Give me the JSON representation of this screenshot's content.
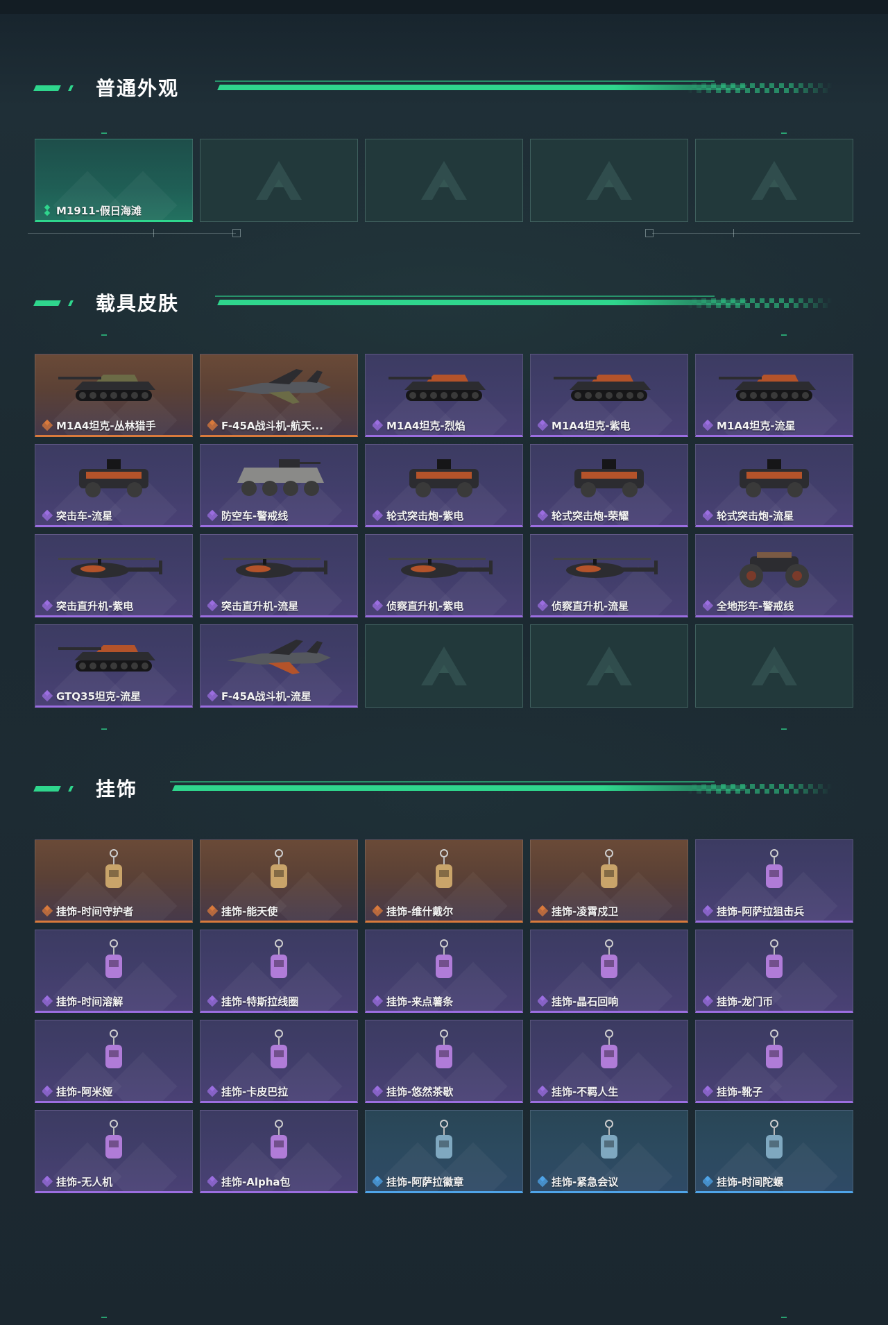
{
  "sections": {
    "normal": {
      "title": "普通外观",
      "items": [
        {
          "label": "M1911-假日海滩",
          "rarity": "green",
          "art": "pistol-icon"
        },
        {
          "label": "",
          "rarity": "empty"
        },
        {
          "label": "",
          "rarity": "empty"
        },
        {
          "label": "",
          "rarity": "empty"
        },
        {
          "label": "",
          "rarity": "empty"
        }
      ]
    },
    "vehicle": {
      "title": "载具皮肤",
      "items": [
        {
          "label": "M1A4坦克-丛林猎手",
          "rarity": "orange",
          "art": "tank-icon"
        },
        {
          "label": "F-45A战斗机-航天...",
          "rarity": "orange",
          "art": "jet-icon"
        },
        {
          "label": "M1A4坦克-烈焰",
          "rarity": "purple",
          "art": "tank-icon"
        },
        {
          "label": "M1A4坦克-紫电",
          "rarity": "purple",
          "art": "tank-icon"
        },
        {
          "label": "M1A4坦克-流星",
          "rarity": "purple",
          "art": "tank-icon"
        },
        {
          "label": "突击车-流星",
          "rarity": "purple",
          "art": "armored-car-icon"
        },
        {
          "label": "防空车-警戒线",
          "rarity": "purple",
          "art": "apc-icon"
        },
        {
          "label": "轮式突击炮-紫电",
          "rarity": "purple",
          "art": "armored-car-icon"
        },
        {
          "label": "轮式突击炮-荣耀",
          "rarity": "purple",
          "art": "armored-car-icon"
        },
        {
          "label": "轮式突击炮-流星",
          "rarity": "purple",
          "art": "armored-car-icon"
        },
        {
          "label": "突击直升机-紫电",
          "rarity": "purple",
          "art": "helicopter-icon"
        },
        {
          "label": "突击直升机-流星",
          "rarity": "purple",
          "art": "helicopter-icon"
        },
        {
          "label": "侦察直升机-紫电",
          "rarity": "purple",
          "art": "helicopter-icon"
        },
        {
          "label": "侦察直升机-流星",
          "rarity": "purple",
          "art": "helicopter-icon"
        },
        {
          "label": "全地形车-警戒线",
          "rarity": "purple",
          "art": "atv-icon"
        },
        {
          "label": "GTQ35坦克-流星",
          "rarity": "purple",
          "art": "tank-icon"
        },
        {
          "label": "F-45A战斗机-流星",
          "rarity": "purple",
          "art": "jet-icon"
        },
        {
          "label": "",
          "rarity": "empty"
        },
        {
          "label": "",
          "rarity": "empty"
        },
        {
          "label": "",
          "rarity": "empty"
        }
      ]
    },
    "charm": {
      "title": "挂饰",
      "items": [
        {
          "label": "挂饰-时间守护者",
          "rarity": "orange",
          "art": "charm-icon"
        },
        {
          "label": "挂饰-能天使",
          "rarity": "orange",
          "art": "charm-icon"
        },
        {
          "label": "挂饰-维什戴尔",
          "rarity": "orange",
          "art": "charm-icon"
        },
        {
          "label": "挂饰-凌霄戍卫",
          "rarity": "orange",
          "art": "charm-icon"
        },
        {
          "label": "挂饰-阿萨拉狙击兵",
          "rarity": "purple",
          "art": "charm-icon"
        },
        {
          "label": "挂饰-时间溶解",
          "rarity": "purple",
          "art": "charm-icon"
        },
        {
          "label": "挂饰-特斯拉线圈",
          "rarity": "purple",
          "art": "charm-icon"
        },
        {
          "label": "挂饰-来点薯条",
          "rarity": "purple",
          "art": "charm-icon"
        },
        {
          "label": "挂饰-晶石回响",
          "rarity": "purple",
          "art": "charm-icon"
        },
        {
          "label": "挂饰-龙门币",
          "rarity": "purple",
          "art": "charm-icon"
        },
        {
          "label": "挂饰-阿米娅",
          "rarity": "purple",
          "art": "charm-icon"
        },
        {
          "label": "挂饰-卡皮巴拉",
          "rarity": "purple",
          "art": "charm-icon"
        },
        {
          "label": "挂饰-悠然茶歇",
          "rarity": "purple",
          "art": "charm-icon"
        },
        {
          "label": "挂饰-不羁人生",
          "rarity": "purple",
          "art": "charm-icon"
        },
        {
          "label": "挂饰-靴子",
          "rarity": "purple",
          "art": "charm-icon"
        },
        {
          "label": "挂饰-无人机",
          "rarity": "purple",
          "art": "charm-icon"
        },
        {
          "label": "挂饰-Alpha包",
          "rarity": "purple",
          "art": "charm-icon"
        },
        {
          "label": "挂饰-阿萨拉徽章",
          "rarity": "blue",
          "art": "charm-icon"
        },
        {
          "label": "挂饰-紧急会议",
          "rarity": "blue",
          "art": "charm-icon"
        },
        {
          "label": "挂饰-时间陀螺",
          "rarity": "blue",
          "art": "charm-icon"
        }
      ]
    }
  },
  "colors": {
    "accent": "#2fd68d",
    "orange": "#d97a3c",
    "purple": "#9b6ee0",
    "blue": "#4fa4e8",
    "green": "#2fd68d"
  }
}
